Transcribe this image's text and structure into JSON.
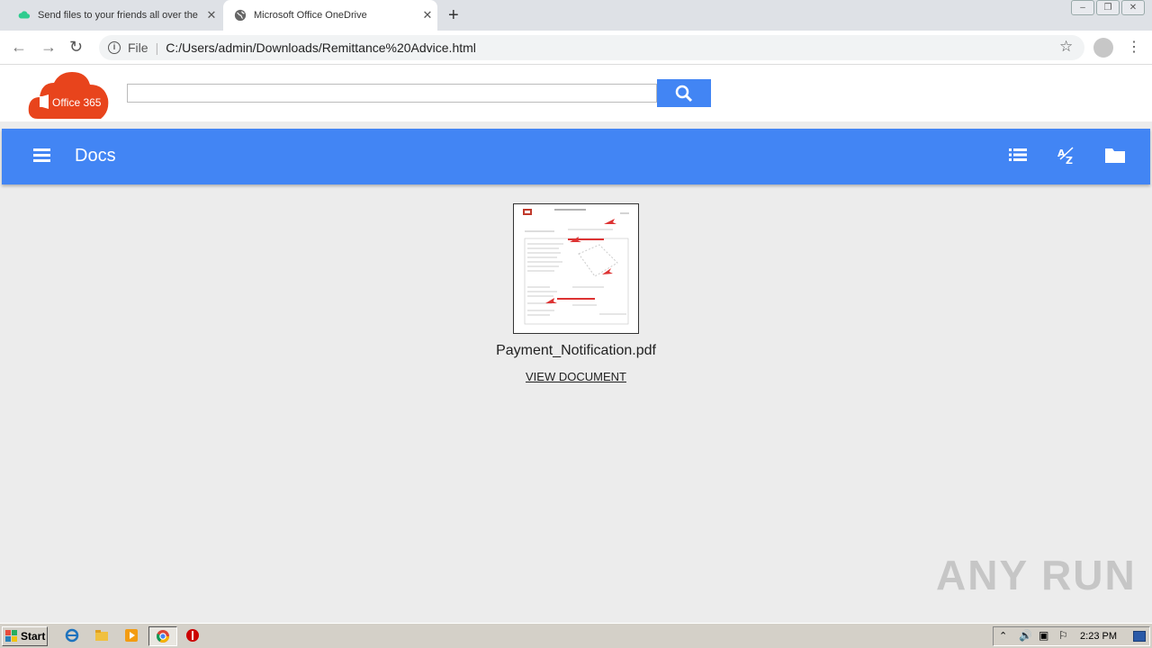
{
  "browser": {
    "tabs": [
      {
        "title": "Send files to your friends all over the"
      },
      {
        "title": "Microsoft Office OneDrive"
      }
    ],
    "url_prefix": "File",
    "url": "C:/Users/admin/Downloads/Remittance%20Advice.html"
  },
  "page": {
    "logo_text": "Office 365",
    "search_placeholder": "",
    "appbar_title": "Docs",
    "document": {
      "name": "Payment_Notification.pdf",
      "link_label": "VIEW DOCUMENT"
    },
    "watermark": "ANY RUN"
  },
  "taskbar": {
    "start_label": "Start",
    "clock": "2:23 PM"
  },
  "colors": {
    "accent": "#4285f4",
    "logo": "#e8441c"
  }
}
